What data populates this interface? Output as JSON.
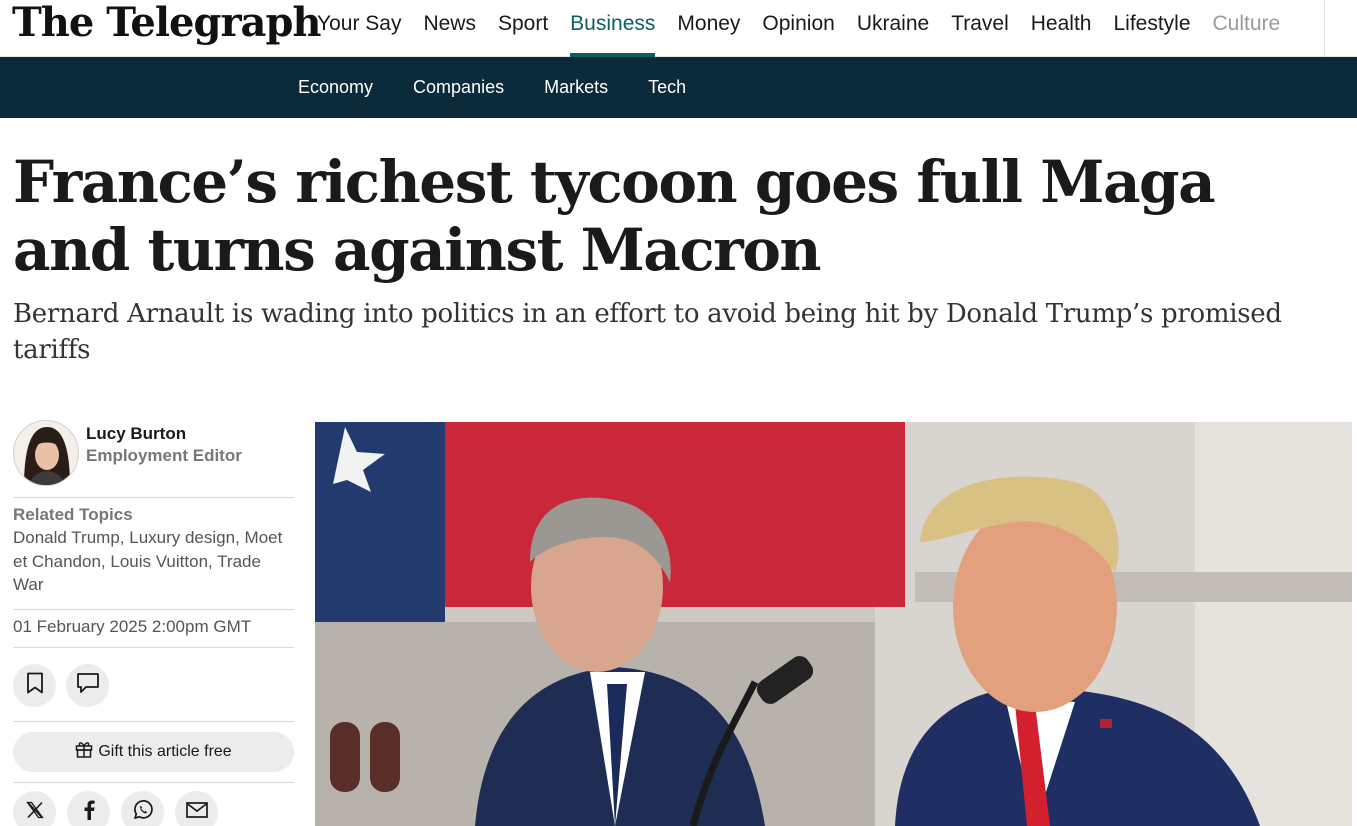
{
  "header": {
    "logo_text": "The Telegraph",
    "nav": [
      {
        "label": "Your Say",
        "state": "normal"
      },
      {
        "label": "News",
        "state": "normal"
      },
      {
        "label": "Sport",
        "state": "normal"
      },
      {
        "label": "Business",
        "state": "active"
      },
      {
        "label": "Money",
        "state": "normal"
      },
      {
        "label": "Opinion",
        "state": "normal"
      },
      {
        "label": "Ukraine",
        "state": "normal"
      },
      {
        "label": "Travel",
        "state": "normal"
      },
      {
        "label": "Health",
        "state": "normal"
      },
      {
        "label": "Lifestyle",
        "state": "normal"
      },
      {
        "label": "Culture",
        "state": "faded"
      }
    ],
    "accent_color": "#0b5f5f"
  },
  "subnav": {
    "background_color": "#0b2a3a",
    "items": [
      "Economy",
      "Companies",
      "Markets",
      "Tech"
    ]
  },
  "article": {
    "headline": "France’s richest tycoon goes full Maga and turns against Macron",
    "standfirst": "Bernard Arnault is wading into politics in an effort to avoid being hit by Donald Trump’s promised tariffs"
  },
  "sidebar": {
    "author": {
      "name": "Lucy Burton",
      "role": "Employment Editor"
    },
    "related_title": "Related Topics",
    "topics": [
      "Donald Trump",
      "Luxury design",
      "Moet et Chandon",
      "Louis Vuitton",
      "Trade War"
    ],
    "published": "01 February 2025 2:00pm GMT",
    "gift_label": "Gift this article free",
    "action_icons": [
      "bookmark-icon",
      "comment-icon"
    ],
    "share_icons": [
      "x-icon",
      "facebook-icon",
      "whatsapp-icon",
      "email-icon"
    ]
  }
}
